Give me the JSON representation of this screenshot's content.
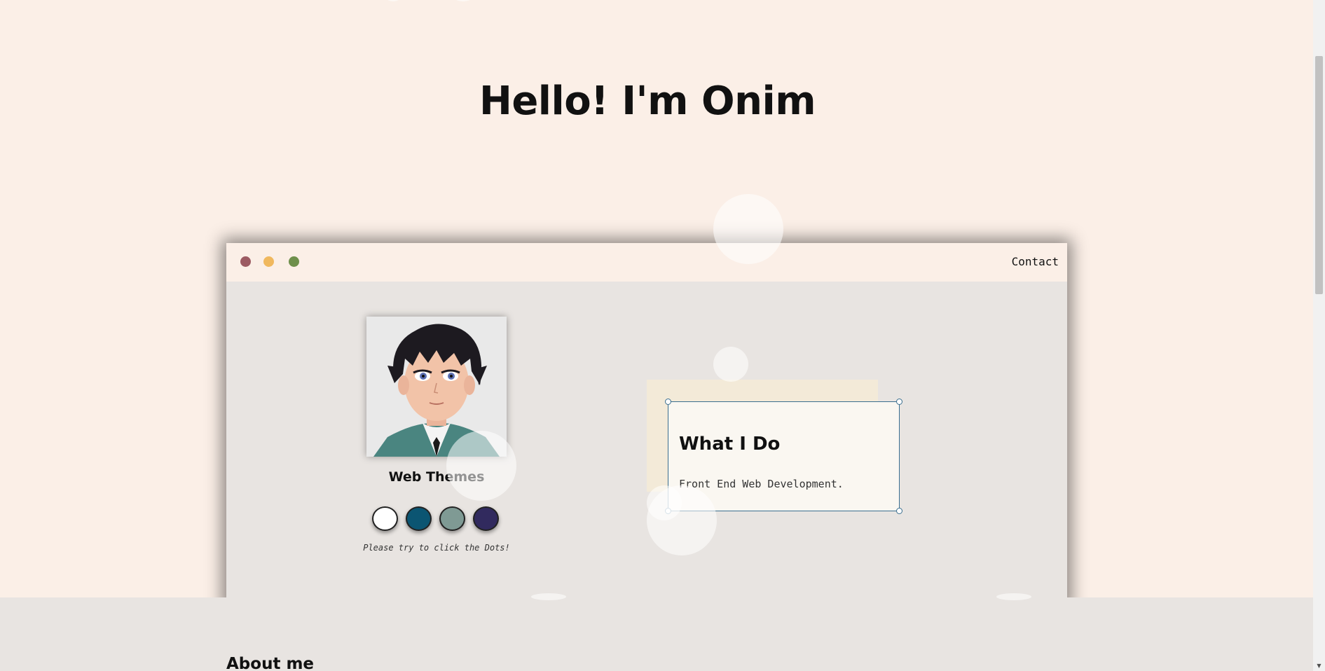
{
  "hero": {
    "title": "Hello! I'm Onim"
  },
  "window": {
    "contact_label": "Contact"
  },
  "themes": {
    "title": "Web Themes",
    "hint": "Please try to click the Dots!",
    "colors": [
      "#ffffff",
      "#0b5572",
      "#7f9a94",
      "#312a5e"
    ]
  },
  "what_i_do": {
    "title": "What I Do",
    "text": "Front End Web Development."
  },
  "about": {
    "title": "About me"
  },
  "icons": {
    "window_controls": [
      "close-dot",
      "minimize-dot",
      "maximize-dot"
    ],
    "avatar": "anime-boy-avatar"
  }
}
